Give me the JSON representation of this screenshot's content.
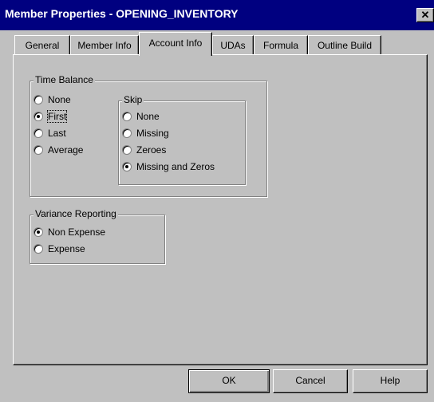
{
  "window": {
    "title": "Member Properties - OPENING_INVENTORY",
    "close_label": "✕"
  },
  "tabs": [
    {
      "label": "General"
    },
    {
      "label": "Member Info"
    },
    {
      "label": "Account Info"
    },
    {
      "label": "UDAs"
    },
    {
      "label": "Formula"
    },
    {
      "label": "Outline Build"
    }
  ],
  "active_tab": "Account Info",
  "time_balance": {
    "label": "Time Balance",
    "options": [
      {
        "label": "None",
        "checked": false
      },
      {
        "label": "First",
        "checked": true
      },
      {
        "label": "Last",
        "checked": false
      },
      {
        "label": "Average",
        "checked": false
      }
    ]
  },
  "skip": {
    "label": "Skip",
    "options": [
      {
        "label": "None",
        "checked": false
      },
      {
        "label": "Missing",
        "checked": false
      },
      {
        "label": "Zeroes",
        "checked": false
      },
      {
        "label": "Missing and Zeros",
        "checked": true
      }
    ]
  },
  "variance_reporting": {
    "label": "Variance Reporting",
    "options": [
      {
        "label": "Non Expense",
        "checked": true
      },
      {
        "label": "Expense",
        "checked": false
      }
    ]
  },
  "buttons": {
    "ok": "OK",
    "cancel": "Cancel",
    "help": "Help"
  }
}
